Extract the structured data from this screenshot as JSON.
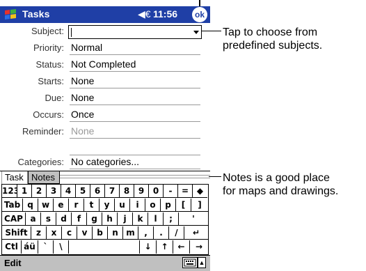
{
  "titlebar": {
    "app_title": "Tasks",
    "time": "11:56",
    "volume_icon": "speaker-icon",
    "ok_label": "ok"
  },
  "fields": [
    {
      "label": "Subject:",
      "value": ""
    },
    {
      "label": "Priority:",
      "value": "Normal"
    },
    {
      "label": "Status:",
      "value": "Not Completed"
    },
    {
      "label": "Starts:",
      "value": "None"
    },
    {
      "label": "Due:",
      "value": "None"
    },
    {
      "label": "Occurs:",
      "value": "Once"
    },
    {
      "label": "Reminder:",
      "value": "None"
    },
    {
      "label": "Categories:",
      "value": "No categories..."
    }
  ],
  "tabs": {
    "task": "Task",
    "notes": "Notes"
  },
  "keyboard": {
    "rows": [
      [
        "123",
        "1",
        "2",
        "3",
        "4",
        "5",
        "6",
        "7",
        "8",
        "9",
        "0",
        "-",
        "=",
        "◆"
      ],
      [
        "Tab",
        "q",
        "w",
        "e",
        "r",
        "t",
        "y",
        "u",
        "i",
        "o",
        "p",
        "[",
        "]"
      ],
      [
        "CAP",
        "a",
        "s",
        "d",
        "f",
        "g",
        "h",
        "j",
        "k",
        "l",
        ";",
        "'"
      ],
      [
        "Shift",
        "z",
        "x",
        "c",
        "v",
        "b",
        "n",
        "m",
        ",",
        ".",
        "/",
        "↵"
      ],
      [
        "Ctl",
        "áü",
        "`",
        "\\",
        "",
        "↓",
        "↑",
        "←",
        "→"
      ]
    ]
  },
  "menubar": {
    "edit": "Edit"
  },
  "callouts": {
    "subject_note": [
      "Tap to choose from",
      "predefined subjects."
    ],
    "notes_note": [
      "Notes is a good place",
      "for maps and drawings."
    ]
  },
  "colors": {
    "titlebar": "#1f3fa6",
    "menubar": "#c0c0c0"
  }
}
